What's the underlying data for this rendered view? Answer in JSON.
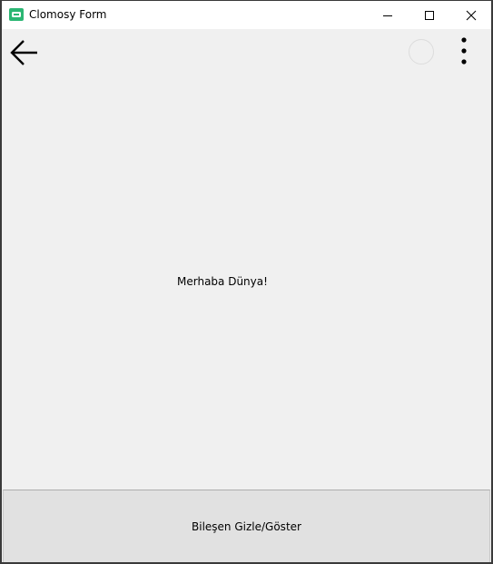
{
  "window": {
    "title": "Clomosy Form",
    "icon": "clomosy-app-icon",
    "accent_color": "#2bb673"
  },
  "titlebar_buttons": {
    "minimize_icon": "minimize-icon",
    "maximize_icon": "maximize-icon",
    "close_icon": "close-icon"
  },
  "appbar": {
    "back_icon": "back-arrow-icon",
    "loading_icon": "loading-circle-icon",
    "more_icon": "more-vertical-icon"
  },
  "main": {
    "label": "Merhaba Dünya!"
  },
  "bottom_button": {
    "label": "Bileşen Gizle/Göster"
  }
}
